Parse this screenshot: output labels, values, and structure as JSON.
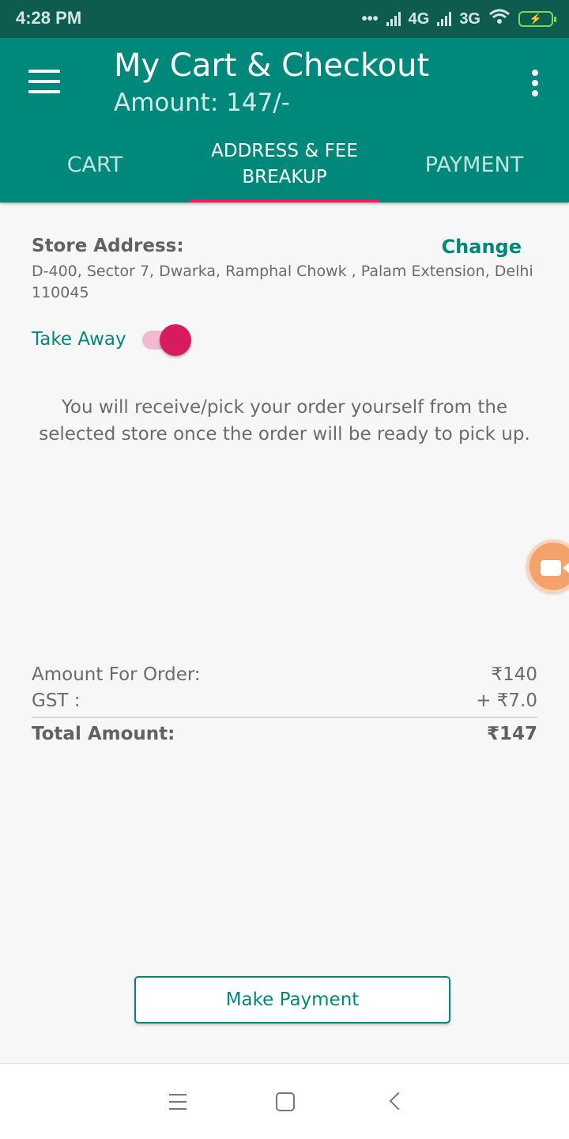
{
  "status_bar": {
    "time": "4:28 PM",
    "network_1": "4G",
    "network_2": "3G"
  },
  "app_bar": {
    "title": "My Cart & Checkout",
    "subtitle": "Amount: 147/-",
    "menu_icon": "hamburger-menu-icon",
    "overflow_icon": "more-vert-icon"
  },
  "tabs": [
    {
      "label": "CART",
      "active": false
    },
    {
      "label": "ADDRESS & FEE BREAKUP",
      "active": true
    },
    {
      "label": "PAYMENT",
      "active": false
    }
  ],
  "store": {
    "label": "Store Address:",
    "change_label": "Change",
    "address": "D-400, Sector 7, Dwarka, Ramphal Chowk , Palam Extension, Delhi 110045"
  },
  "take_away": {
    "label": "Take Away",
    "enabled": true
  },
  "pickup_note": "You will receive/pick your order  yourself from the selected store once the order will be ready to pick up.",
  "fees": {
    "order_label": "Amount For Order:",
    "order_value": "₹140",
    "gst_label": "GST :",
    "gst_value": "+ ₹7.0",
    "total_label": "Total Amount:",
    "total_value": "₹147"
  },
  "action": {
    "pay_label": "Make Payment"
  },
  "colors": {
    "primary": "#00897b",
    "primary_dark": "#0d5c4f",
    "accent": "#e91e63",
    "fab": "#f3a26b"
  }
}
